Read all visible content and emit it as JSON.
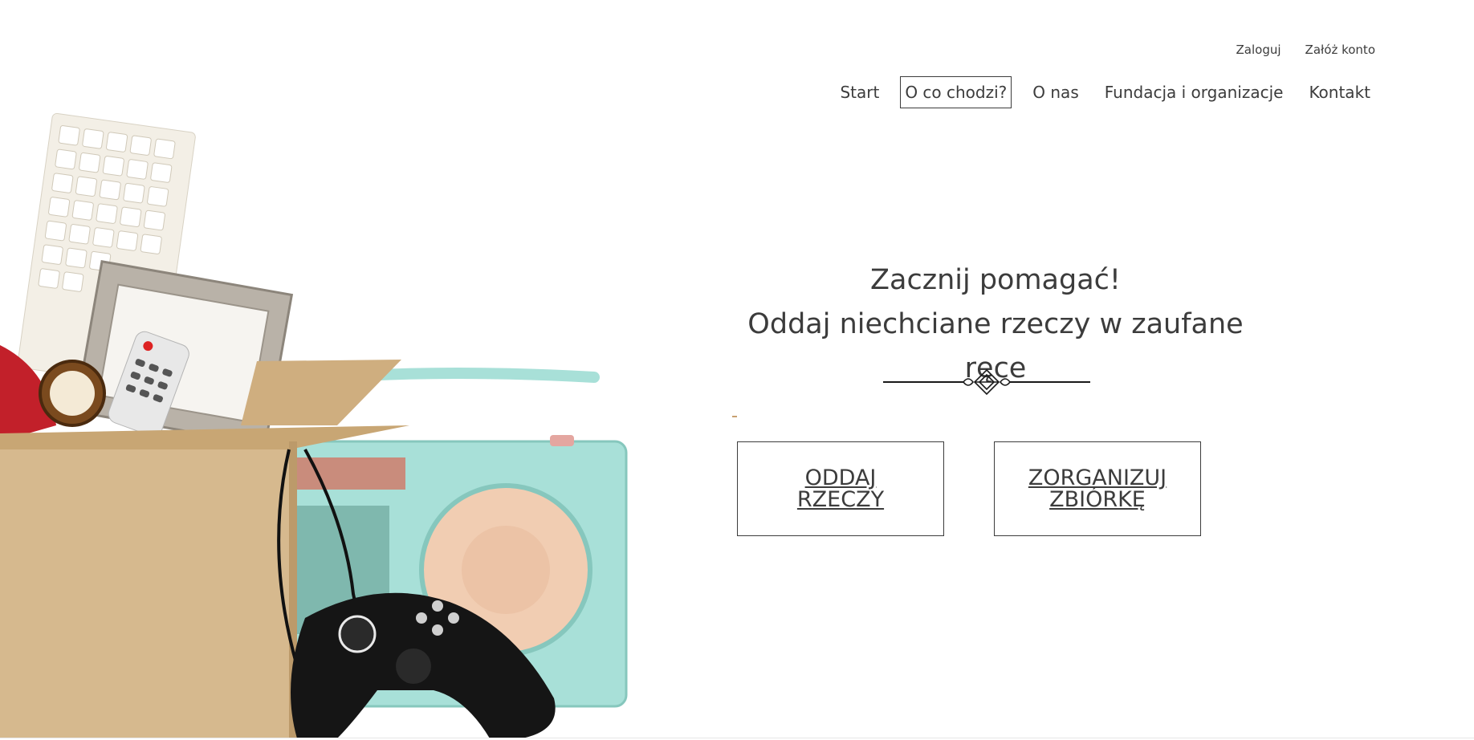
{
  "header": {
    "auth": {
      "login_label": "Zaloguj",
      "register_label": "Załóż konto"
    },
    "nav": {
      "items": [
        {
          "label": "Start",
          "active": false
        },
        {
          "label": "O co chodzi?",
          "active": true
        },
        {
          "label": "O nas",
          "active": false
        },
        {
          "label": "Fundacja i organizacje",
          "active": false
        },
        {
          "label": "Kontakt",
          "active": false
        }
      ]
    }
  },
  "hero": {
    "title_line1": "Zacznij pomagać!",
    "title_line2": "Oddaj niechciane rzeczy w zaufane ręce",
    "buttons": {
      "give_label": "ODDAJ RZECZY",
      "organize_label": "ZORGANIZUJ ZBIÓRKĘ"
    }
  },
  "colors": {
    "text": "#3c3c3c",
    "box": "#d6b98e",
    "radio": "#a8e0d8",
    "speaker": "#f1cdb2"
  }
}
